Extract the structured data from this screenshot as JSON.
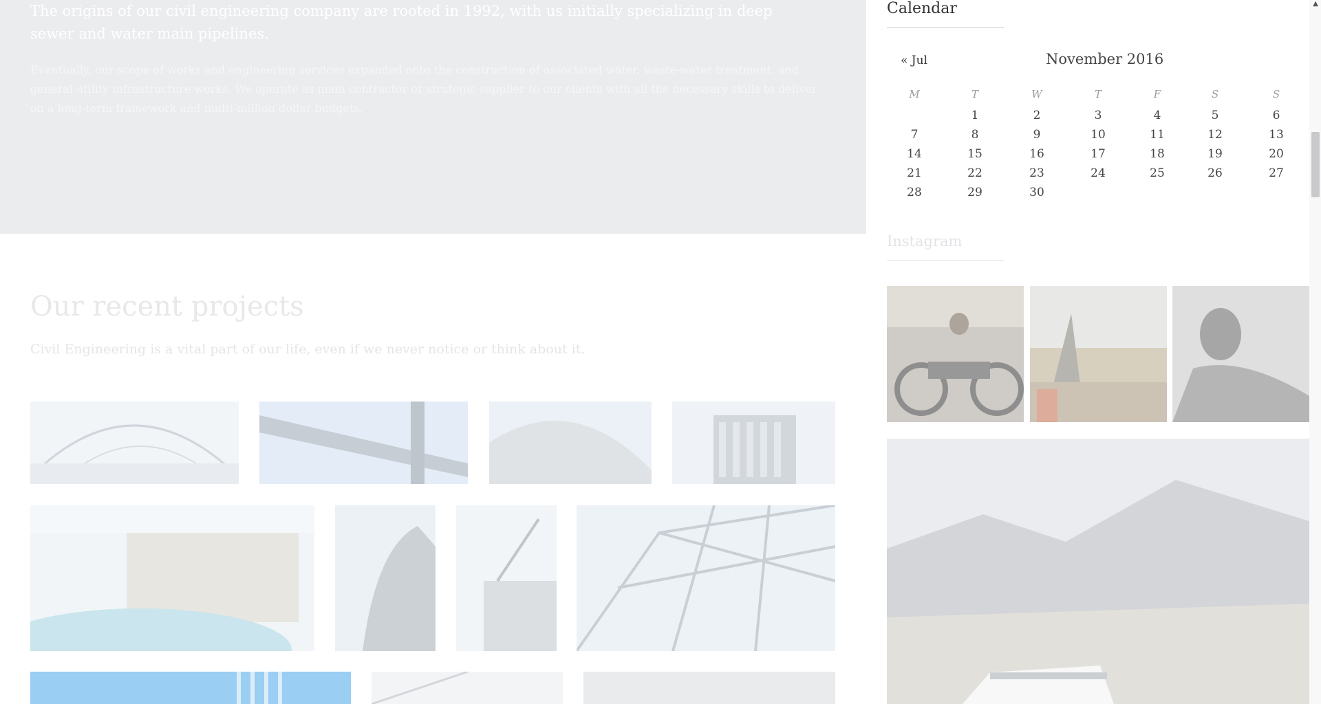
{
  "about": {
    "lead": "The origins of our civil engineering company are rooted in 1992, with us initially specializing in deep sewer and water main pipelines.",
    "body": "Eventually, our scope of works and engineering services expanded onto the construction of associated water, waste-water treatment, and general utility infrastructure works. We operate as main contractor or strategic supplier to our clients with all the necessary skills to deliver on a long-term framework and multi-million dollar budgets."
  },
  "projects": {
    "title": "Our recent projects",
    "subtitle": "Civil Engineering is a vital part of our life, even if we never notice or think about it."
  },
  "calendar": {
    "title": "Calendar",
    "prev_link": "« Jul",
    "month": "November 2016",
    "weekdays": [
      "M",
      "T",
      "W",
      "T",
      "F",
      "S",
      "S"
    ],
    "weeks": [
      [
        "",
        "1",
        "2",
        "3",
        "4",
        "5",
        "6"
      ],
      [
        "7",
        "8",
        "9",
        "10",
        "11",
        "12",
        "13"
      ],
      [
        "14",
        "15",
        "16",
        "17",
        "18",
        "19",
        "20"
      ],
      [
        "21",
        "22",
        "23",
        "24",
        "25",
        "26",
        "27"
      ],
      [
        "28",
        "29",
        "30",
        "",
        "",
        "",
        ""
      ]
    ]
  },
  "instagram": {
    "title": "Instagram"
  },
  "colors": {
    "accent_bg": "#ebecee",
    "text": "#333333"
  }
}
